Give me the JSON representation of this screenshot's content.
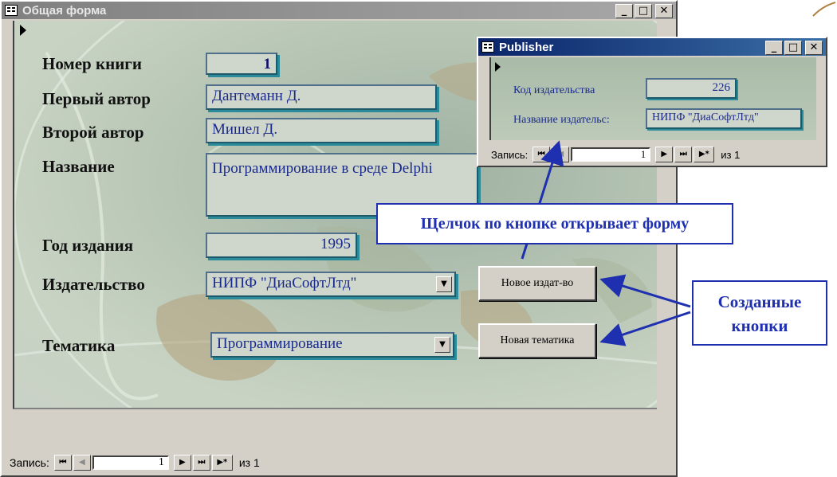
{
  "main_form": {
    "title": "Общая форма",
    "fields": {
      "book_number": {
        "label": "Номер книги",
        "value": "1"
      },
      "first_author": {
        "label": "Первый автор",
        "value": "Дантеманн Д."
      },
      "second_author": {
        "label": "Второй автор",
        "value": "Мишел Д."
      },
      "title": {
        "label": "Название",
        "value": "Программирование в среде Delphi"
      },
      "year": {
        "label": "Год издания",
        "value": "1995"
      },
      "publisher": {
        "label": "Издательство",
        "value": "НИПФ \"ДиаСофтЛтд\""
      },
      "topic": {
        "label": "Тематика",
        "value": "Программирование"
      }
    },
    "buttons": {
      "new_publisher": "Новое издат-во",
      "new_topic": "Новая тематика"
    },
    "nav": {
      "label": "Запись:",
      "current": "1",
      "total": "из 1"
    }
  },
  "publisher_form": {
    "title": "Publisher",
    "fields": {
      "code": {
        "label": "Код издательства",
        "value": "226"
      },
      "name": {
        "label": "Название издательс:",
        "value": "НИПФ \"ДиаСофтЛтд\""
      }
    },
    "nav": {
      "label": "Запись:",
      "current": "1",
      "total": "из 1"
    }
  },
  "annotations": {
    "opens_form": "Щелчок по кнопке открывает форму",
    "created_buttons": "Созданные кнопки"
  },
  "icons": {
    "minimize": "minimize-icon",
    "maximize": "maximize-icon",
    "close": "close-icon",
    "nav_first": "nav-first-icon",
    "nav_prev": "nav-prev-icon",
    "nav_next": "nav-next-icon",
    "nav_last": "nav-last-icon",
    "nav_new": "nav-new-record-icon",
    "dropdown": "dropdown-arrow-icon",
    "record_selector": "record-selector-icon"
  },
  "colors": {
    "title_inactive": "#8a8a8a",
    "title_active": "#0a246a",
    "callout": "#1e2fb0",
    "window_bg": "#d4d0c8"
  }
}
